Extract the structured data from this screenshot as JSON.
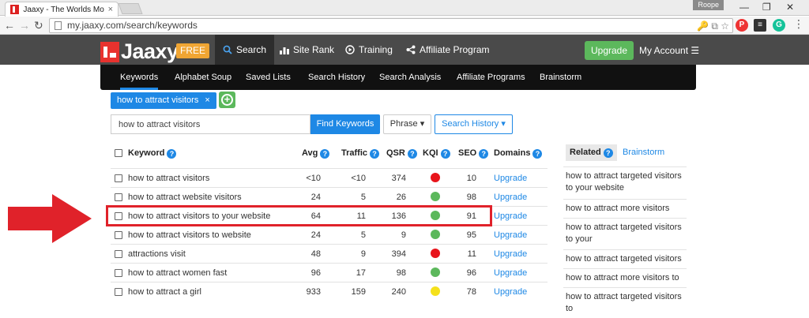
{
  "browser": {
    "tab_title": "Jaaxy - The Worlds Most A",
    "tab_close": "×",
    "profile": "Roope",
    "url": "my.jaaxy.com/search/keywords"
  },
  "header": {
    "logo": "Jaaxy",
    "badge": "FREE",
    "nav": [
      {
        "label": "Search"
      },
      {
        "label": "Site Rank"
      },
      {
        "label": "Training"
      },
      {
        "label": "Affiliate Program"
      }
    ],
    "upgrade": "Upgrade",
    "account": "My Account"
  },
  "subnav": [
    "Keywords",
    "Alphabet Soup",
    "Saved Lists",
    "Search History",
    "Search Analysis",
    "Affiliate Programs",
    "Brainstorm"
  ],
  "search": {
    "chip": "how to attract visitors",
    "chip_close": "×",
    "input_value": "how to attract visitors",
    "find_button": "Find Keywords",
    "phrase_button": "Phrase",
    "history_button": "Search History"
  },
  "table": {
    "headers": {
      "keyword": "Keyword",
      "avg": "Avg",
      "traffic": "Traffic",
      "qsr": "QSR",
      "kqi": "KQI",
      "seo": "SEO",
      "domains": "Domains"
    },
    "rows": [
      {
        "keyword": "how to attract visitors",
        "avg": "<10",
        "traffic": "<10",
        "qsr": "374",
        "kqi": "red",
        "seo": "10",
        "domains": "Upgrade"
      },
      {
        "keyword": "how to attract website visitors",
        "avg": "24",
        "traffic": "5",
        "qsr": "26",
        "kqi": "green",
        "seo": "98",
        "domains": "Upgrade"
      },
      {
        "keyword": "how to attract visitors to your website",
        "avg": "64",
        "traffic": "11",
        "qsr": "136",
        "kqi": "green",
        "seo": "91",
        "domains": "Upgrade"
      },
      {
        "keyword": "how to attract visitors to website",
        "avg": "24",
        "traffic": "5",
        "qsr": "9",
        "kqi": "green",
        "seo": "95",
        "domains": "Upgrade"
      },
      {
        "keyword": "attractions visit",
        "avg": "48",
        "traffic": "9",
        "qsr": "394",
        "kqi": "red",
        "seo": "11",
        "domains": "Upgrade"
      },
      {
        "keyword": "how to attract women fast",
        "avg": "96",
        "traffic": "17",
        "qsr": "98",
        "kqi": "green",
        "seo": "96",
        "domains": "Upgrade"
      },
      {
        "keyword": "how to attract a girl",
        "avg": "933",
        "traffic": "159",
        "qsr": "240",
        "kqi": "yellow",
        "seo": "78",
        "domains": "Upgrade"
      }
    ]
  },
  "kqi_colors": {
    "red": "#e8141b",
    "green": "#5cb85c",
    "yellow": "#f5e11b"
  },
  "sidebar": {
    "tab_related": "Related",
    "tab_brainstorm": "Brainstorm",
    "items": [
      "how to attract targeted visitors to your website",
      "how to attract more visitors",
      "how to attract targeted visitors to your",
      "how to attract targeted visitors",
      "how to attract more visitors to",
      "how to attract targeted visitors to"
    ]
  }
}
